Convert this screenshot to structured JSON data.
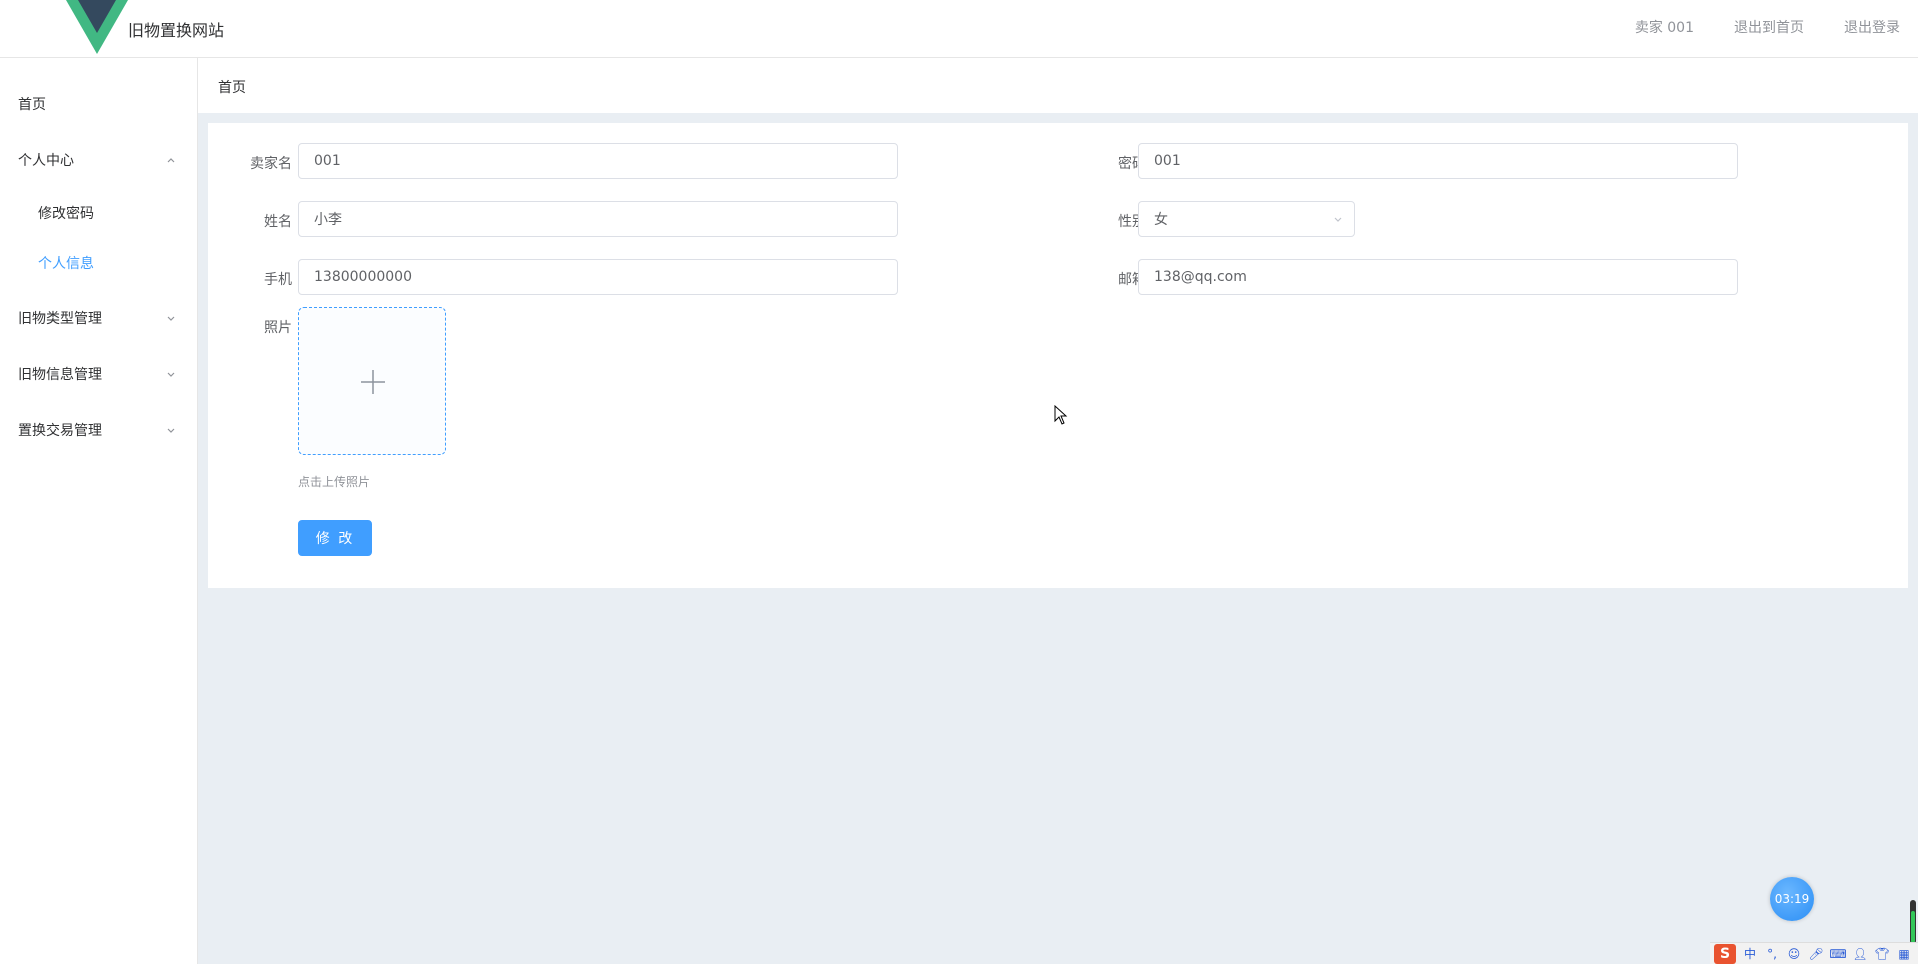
{
  "header": {
    "site_title": "旧物置换网站",
    "user_label": "卖家 001",
    "back_home_label": "退出到首页",
    "logout_label": "退出登录"
  },
  "sidebar": {
    "items": [
      {
        "label": "首页"
      },
      {
        "label": "个人中心"
      },
      {
        "label": "修改密码"
      },
      {
        "label": "个人信息"
      },
      {
        "label": "旧物类型管理"
      },
      {
        "label": "旧物信息管理"
      },
      {
        "label": "置换交易管理"
      }
    ]
  },
  "breadcrumb": "首页",
  "form": {
    "seller_name": {
      "label": "卖家名",
      "value": "001"
    },
    "password": {
      "label": "密码",
      "value": "001"
    },
    "name": {
      "label": "姓名",
      "value": "小李"
    },
    "gender": {
      "label": "性别",
      "value": "女"
    },
    "phone": {
      "label": "手机",
      "value": "13800000000"
    },
    "email": {
      "label": "邮箱",
      "value": "138@qq.com"
    },
    "photo": {
      "label": "照片",
      "tip": "点击上传照片"
    },
    "submit_label": "修 改"
  },
  "widgets": {
    "timer": "03:19",
    "ime_logo": "S",
    "ime_mode": "中"
  },
  "colors": {
    "accent": "#409eff",
    "main_bg": "#e9eef3",
    "logo_green": "#41b883",
    "logo_dark": "#34495e"
  }
}
